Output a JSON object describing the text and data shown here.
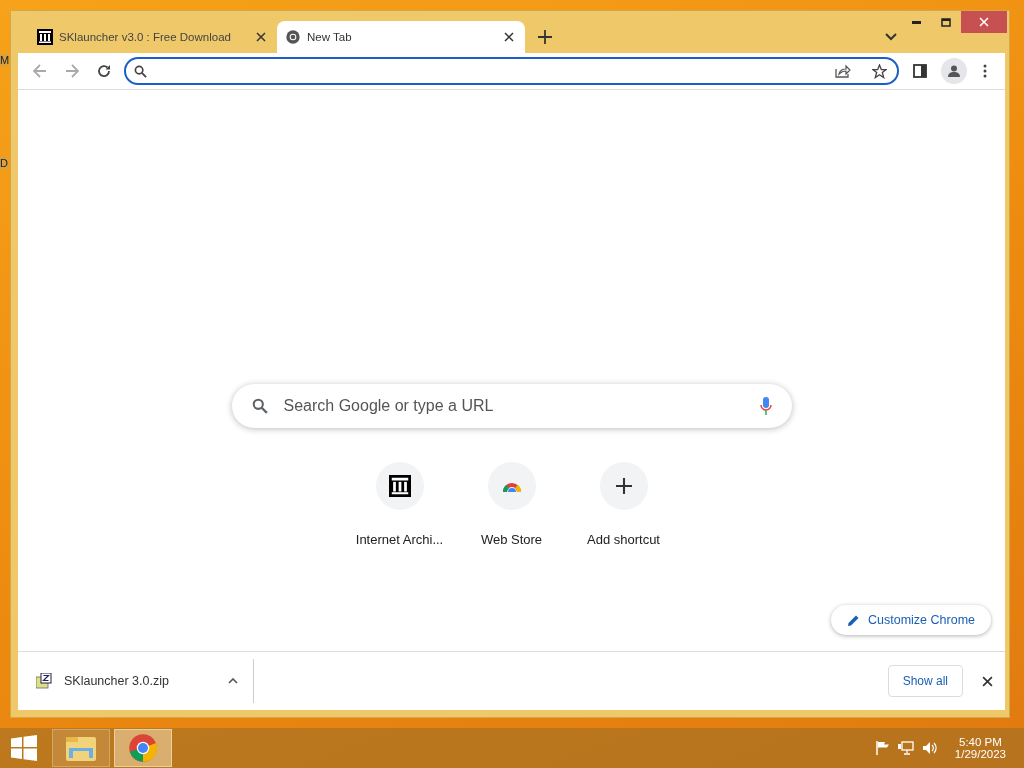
{
  "desktop": {
    "labels": [
      "M",
      "D"
    ]
  },
  "window": {
    "tabs": [
      {
        "title": "SKlauncher v3.0 : Free Download",
        "kind": "archive",
        "selected": false
      },
      {
        "title": "New Tab",
        "kind": "chrome",
        "selected": true
      }
    ]
  },
  "search": {
    "placeholder": "Search Google or type a URL"
  },
  "shortcuts": [
    {
      "label": "Internet Archi...",
      "kind": "archive"
    },
    {
      "label": "Web Store",
      "kind": "webstore"
    },
    {
      "label": "Add shortcut",
      "kind": "add"
    }
  ],
  "customize_button": "Customize Chrome",
  "download_bar": {
    "file": "SKlauncher 3.0.zip",
    "show_all": "Show all"
  },
  "taskbar": {
    "apps": [
      {
        "kind": "explorer",
        "selected": false
      },
      {
        "kind": "chrome",
        "selected": true
      }
    ],
    "time": "5:40 PM",
    "date": "1/29/2023"
  }
}
